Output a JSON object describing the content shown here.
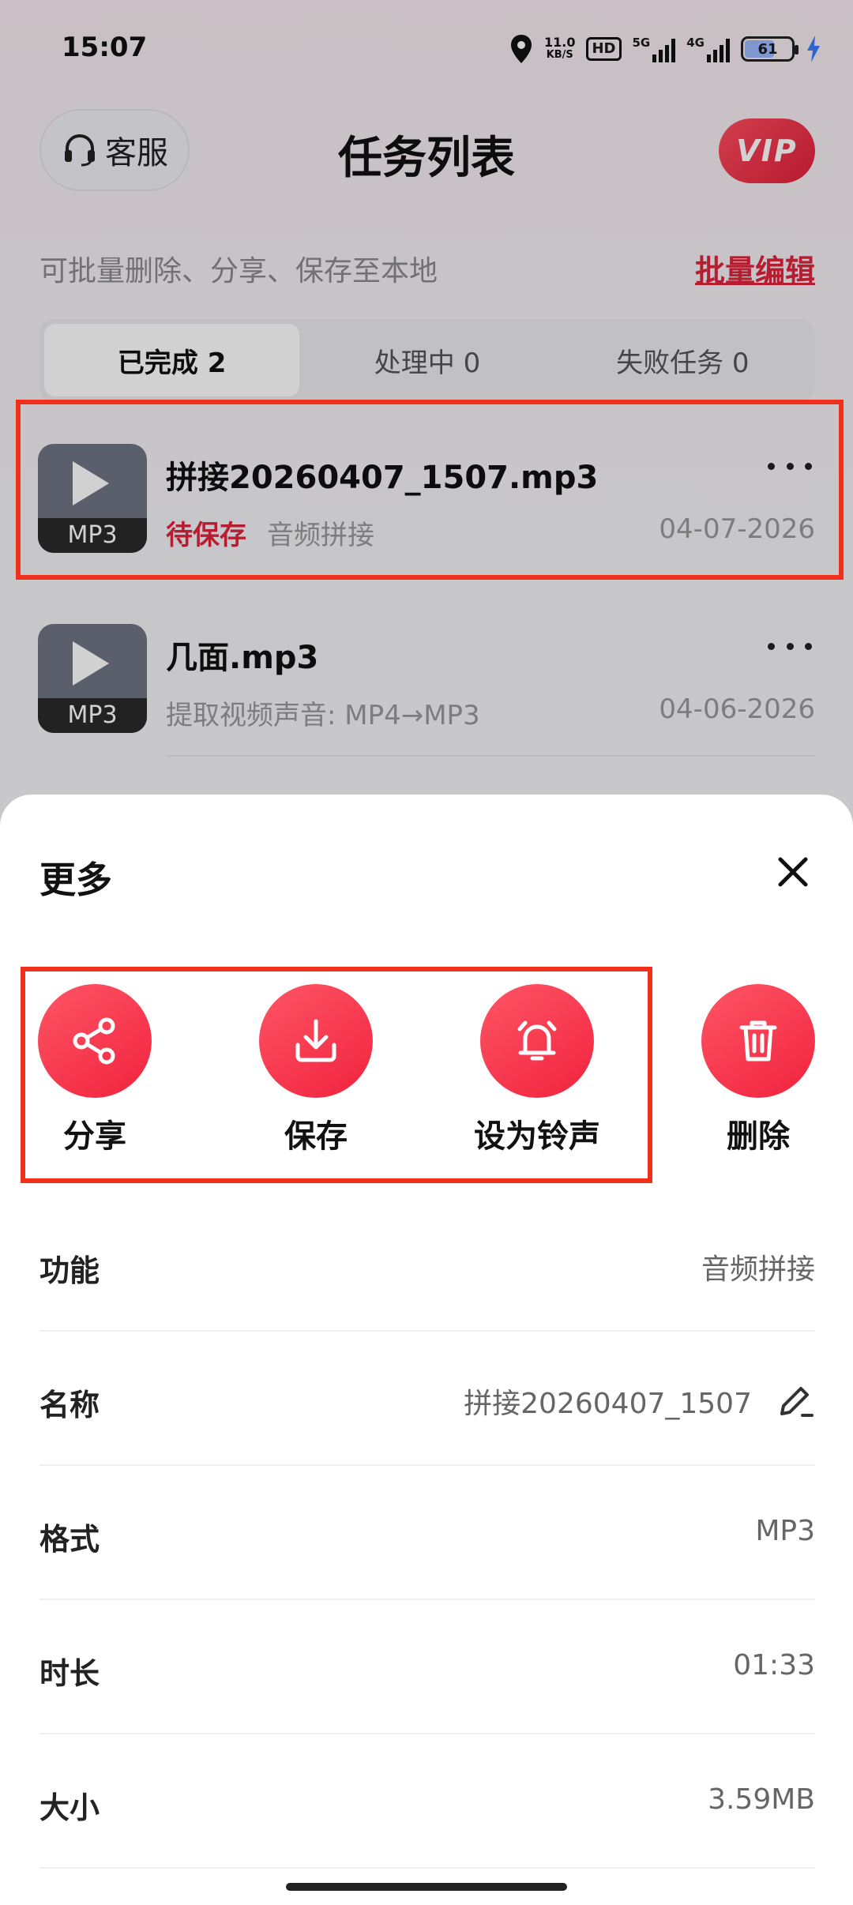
{
  "status_bar": {
    "time": "15:07",
    "net_speed": "11.0",
    "net_unit": "KB/S",
    "hd": "HD",
    "sig1": "5G",
    "sig2": "4G",
    "battery": "61"
  },
  "header": {
    "service_label": "客服",
    "title": "任务列表",
    "vip_label": "VIP",
    "hint": "可批量删除、分享、保存至本地",
    "batch_edit": "批量编辑"
  },
  "tabs": [
    {
      "label": "已完成 2",
      "active": true
    },
    {
      "label": "处理中 0",
      "active": false
    },
    {
      "label": "失败任务 0",
      "active": false
    }
  ],
  "tasks": [
    {
      "thumb_label": "MP3",
      "name": "拼接20260407_1507.mp3",
      "status": "待保存",
      "desc": "音频拼接",
      "date": "04-07-2026"
    },
    {
      "thumb_label": "MP3",
      "name": "几面.mp3",
      "desc": "提取视频声音: MP4→MP3",
      "date": "04-06-2026"
    }
  ],
  "sheet": {
    "title": "更多",
    "actions": [
      {
        "label": "分享",
        "icon": "share-icon"
      },
      {
        "label": "保存",
        "icon": "download-icon"
      },
      {
        "label": "设为铃声",
        "icon": "bell-icon"
      },
      {
        "label": "删除",
        "icon": "trash-icon"
      }
    ],
    "info": [
      {
        "key": "功能",
        "value": "音频拼接"
      },
      {
        "key": "名称",
        "value": "拼接20260407_1507"
      },
      {
        "key": "格式",
        "value": "MP3"
      },
      {
        "key": "时长",
        "value": "01:33"
      },
      {
        "key": "大小",
        "value": "3.59MB"
      }
    ]
  },
  "colors": {
    "accent": "#e0243c",
    "highlight_box": "#f0301a"
  }
}
